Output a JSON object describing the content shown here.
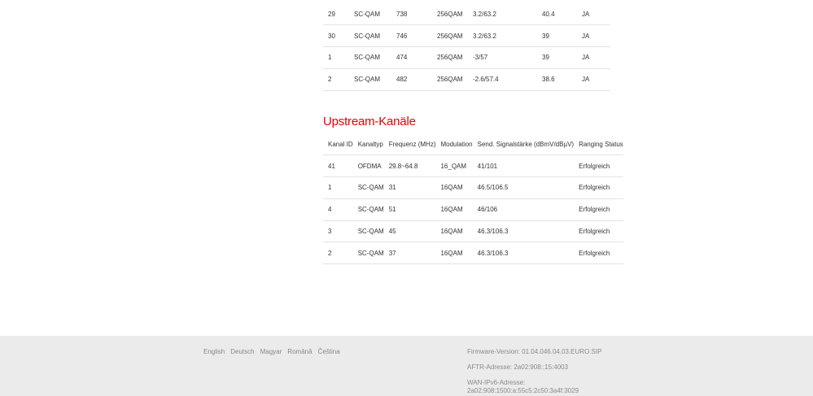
{
  "downstream": {
    "rows": [
      {
        "id": "29",
        "type": "SC-QAM",
        "freq": "738",
        "mod": "256QAM",
        "power": "3.2/63.2",
        "snr": "40.4",
        "locked": "JA"
      },
      {
        "id": "30",
        "type": "SC-QAM",
        "freq": "746",
        "mod": "256QAM",
        "power": "3.2/63.2",
        "snr": "39",
        "locked": "JA"
      },
      {
        "id": "1",
        "type": "SC-QAM",
        "freq": "474",
        "mod": "256QAM",
        "power": "-3/57",
        "snr": "39",
        "locked": "JA"
      },
      {
        "id": "2",
        "type": "SC-QAM",
        "freq": "482",
        "mod": "256QAM",
        "power": "-2.6/57.4",
        "snr": "38.6",
        "locked": "JA"
      }
    ]
  },
  "upstream": {
    "title": "Upstream-Kanäle",
    "headers": [
      "Kanal ID",
      "Kanaltyp",
      "Frequenz (MHz)",
      "Modulation",
      "Send. Signalstärke (dBmV/dBµV)",
      "Ranging Status"
    ],
    "rows": [
      {
        "id": "41",
        "type": "OFDMA",
        "freq": "29.8~64.8",
        "mod": "16_QAM",
        "power": "41/101",
        "status": "Erfolgreich"
      },
      {
        "id": "1",
        "type": "SC-QAM",
        "freq": "31",
        "mod": "16QAM",
        "power": "46.5/106.5",
        "status": "Erfolgreich"
      },
      {
        "id": "4",
        "type": "SC-QAM",
        "freq": "51",
        "mod": "16QAM",
        "power": "46/106",
        "status": "Erfolgreich"
      },
      {
        "id": "3",
        "type": "SC-QAM",
        "freq": "45",
        "mod": "16QAM",
        "power": "46.3/106.3",
        "status": "Erfolgreich"
      },
      {
        "id": "2",
        "type": "SC-QAM",
        "freq": "37",
        "mod": "16QAM",
        "power": "46.3/106.3",
        "status": "Erfolgreich"
      }
    ]
  },
  "footer": {
    "languages": [
      "English",
      "Deutsch",
      "Magyar",
      "Română",
      "Čeština"
    ],
    "firmware": "Firmware-Version: 01.04.046.04.03.EURO.SIP",
    "aftr": "AFTR-Adresse: 2a02:908::15:4003",
    "wan_label": "WAN-IPv6-Adresse:",
    "wan_value": "2a02:908:1500:a:55c5:2c50:3a4f:3029"
  },
  "colors": {
    "accent": "#e60000",
    "footer_bg": "#ebebeb",
    "footer_text": "#8a8a8a",
    "row_divider": "#e3e3e3"
  }
}
